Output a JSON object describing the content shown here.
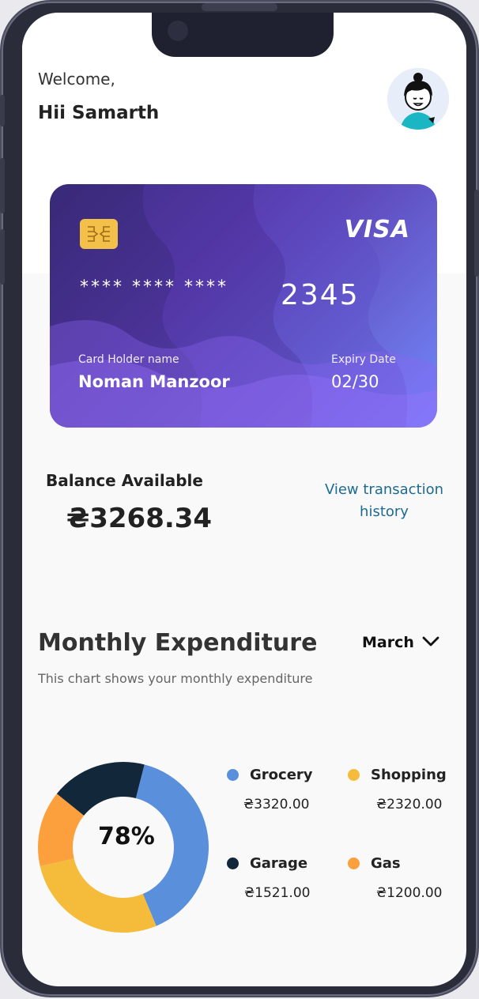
{
  "header": {
    "welcome": "Welcome,",
    "greeting": "Hii  Samarth"
  },
  "card": {
    "brand": "VISA",
    "masked_number": "**** **** ****",
    "last_digits": "2345",
    "holder_label": "Card Holder name",
    "holder_name": "Noman Manzoor",
    "expiry_label": "Expiry Date",
    "expiry_value": "02/30"
  },
  "balance": {
    "label": "Balance Available",
    "value": "₴3268.34",
    "history_link": "View transaction history"
  },
  "expenditure": {
    "title": "Monthly Expenditure",
    "month": "March",
    "subtitle": "This chart shows your monthly expenditure",
    "center_label": "78%"
  },
  "chart_data": {
    "type": "pie",
    "center_label": "78%",
    "slices": [
      {
        "name": "Grocery",
        "amount": "₴3320.00",
        "value": 3320.0,
        "color": "#5a8fdc"
      },
      {
        "name": "Shopping",
        "amount": "₴2320.00",
        "value": 2320.0,
        "color": "#f4bc3a"
      },
      {
        "name": "Gas",
        "amount": "₴1200.00",
        "value": 1200.0,
        "color": "#fba03c"
      },
      {
        "name": "Garage",
        "amount": "₴1521.00",
        "value": 1521.0,
        "color": "#13273b"
      }
    ]
  },
  "icons": {
    "chevron": "chevron-down-icon",
    "chip": "card-chip-icon",
    "avatar": "avatar"
  }
}
